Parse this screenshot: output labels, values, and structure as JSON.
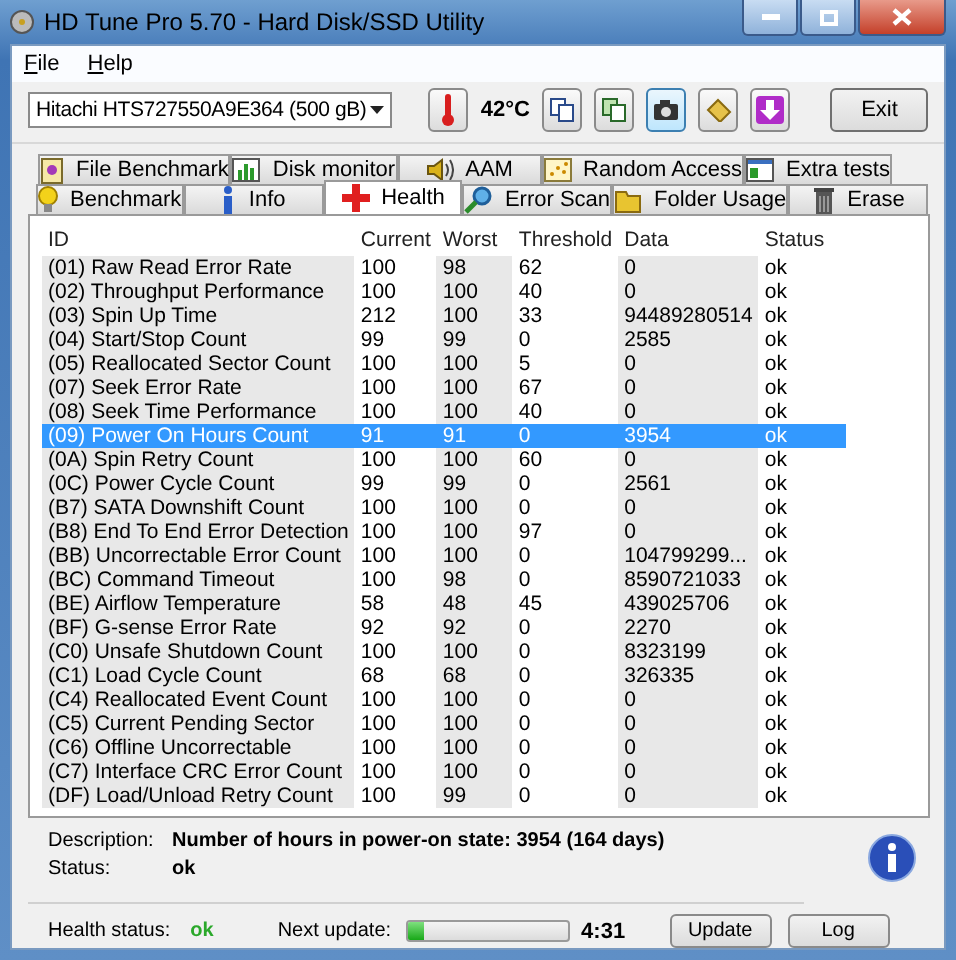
{
  "window": {
    "title": "HD Tune Pro 5.70 - Hard Disk/SSD Utility"
  },
  "menu": [
    "File",
    "Help"
  ],
  "toolbar": {
    "drive": "Hitachi HTS727550A9E364 (500 gB)",
    "temperature": "42°C",
    "exit": "Exit"
  },
  "tab_rows": [
    [
      {
        "label": "File Benchmark",
        "selected": false
      },
      {
        "label": "Disk monitor",
        "selected": false
      },
      {
        "label": "AAM",
        "selected": false
      },
      {
        "label": "Random Access",
        "selected": false
      },
      {
        "label": "Extra tests",
        "selected": false
      }
    ],
    [
      {
        "label": "Benchmark",
        "selected": false
      },
      {
        "label": "Info",
        "selected": false
      },
      {
        "label": "Health",
        "selected": true
      },
      {
        "label": "Error Scan",
        "selected": false
      },
      {
        "label": "Folder Usage",
        "selected": false
      },
      {
        "label": "Erase",
        "selected": false
      }
    ]
  ],
  "table": {
    "columns": [
      "ID",
      "Current",
      "Worst",
      "Threshold",
      "Data",
      "Status"
    ],
    "rows": [
      {
        "cells": [
          "(01) Raw Read Error Rate",
          "100",
          "98",
          "62",
          "0",
          "ok"
        ],
        "selected": false
      },
      {
        "cells": [
          "(02) Throughput Performance",
          "100",
          "100",
          "40",
          "0",
          "ok"
        ],
        "selected": false
      },
      {
        "cells": [
          "(03) Spin Up Time",
          "212",
          "100",
          "33",
          "94489280514",
          "ok"
        ],
        "selected": false
      },
      {
        "cells": [
          "(04) Start/Stop Count",
          "99",
          "99",
          "0",
          "2585",
          "ok"
        ],
        "selected": false
      },
      {
        "cells": [
          "(05) Reallocated Sector Count",
          "100",
          "100",
          "5",
          "0",
          "ok"
        ],
        "selected": false
      },
      {
        "cells": [
          "(07) Seek Error Rate",
          "100",
          "100",
          "67",
          "0",
          "ok"
        ],
        "selected": false
      },
      {
        "cells": [
          "(08) Seek Time Performance",
          "100",
          "100",
          "40",
          "0",
          "ok"
        ],
        "selected": false
      },
      {
        "cells": [
          "(09) Power On Hours Count",
          "91",
          "91",
          "0",
          "3954",
          "ok"
        ],
        "selected": true
      },
      {
        "cells": [
          "(0A) Spin Retry Count",
          "100",
          "100",
          "60",
          "0",
          "ok"
        ],
        "selected": false
      },
      {
        "cells": [
          "(0C) Power Cycle Count",
          "99",
          "99",
          "0",
          "2561",
          "ok"
        ],
        "selected": false
      },
      {
        "cells": [
          "(B7) SATA Downshift Count",
          "100",
          "100",
          "0",
          "0",
          "ok"
        ],
        "selected": false
      },
      {
        "cells": [
          "(B8) End To End Error Detection",
          "100",
          "100",
          "97",
          "0",
          "ok"
        ],
        "selected": false
      },
      {
        "cells": [
          "(BB) Uncorrectable Error Count",
          "100",
          "100",
          "0",
          "104799299...",
          "ok"
        ],
        "selected": false
      },
      {
        "cells": [
          "(BC) Command Timeout",
          "100",
          "98",
          "0",
          "8590721033",
          "ok"
        ],
        "selected": false
      },
      {
        "cells": [
          "(BE) Airflow Temperature",
          "58",
          "48",
          "45",
          "439025706",
          "ok"
        ],
        "selected": false
      },
      {
        "cells": [
          "(BF) G-sense Error Rate",
          "92",
          "92",
          "0",
          "2270",
          "ok"
        ],
        "selected": false
      },
      {
        "cells": [
          "(C0) Unsafe Shutdown Count",
          "100",
          "100",
          "0",
          "8323199",
          "ok"
        ],
        "selected": false
      },
      {
        "cells": [
          "(C1) Load Cycle Count",
          "68",
          "68",
          "0",
          "326335",
          "ok"
        ],
        "selected": false
      },
      {
        "cells": [
          "(C4) Reallocated Event Count",
          "100",
          "100",
          "0",
          "0",
          "ok"
        ],
        "selected": false
      },
      {
        "cells": [
          "(C5) Current Pending Sector",
          "100",
          "100",
          "0",
          "0",
          "ok"
        ],
        "selected": false
      },
      {
        "cells": [
          "(C6) Offline Uncorrectable",
          "100",
          "100",
          "0",
          "0",
          "ok"
        ],
        "selected": false
      },
      {
        "cells": [
          "(C7) Interface CRC Error Count",
          "100",
          "100",
          "0",
          "0",
          "ok"
        ],
        "selected": false
      },
      {
        "cells": [
          "(DF) Load/Unload Retry Count",
          "100",
          "99",
          "0",
          "0",
          "ok"
        ],
        "selected": false
      }
    ]
  },
  "details": {
    "description_label": "Description:",
    "description": "Number of hours in power-on state: 3954 (164 days)",
    "status_label": "Status:",
    "status": "ok"
  },
  "footer": {
    "health_label": "Health status:",
    "health": "ok",
    "next_update_label": "Next update:",
    "update_progress": {
      "level": 0.1
    },
    "countdown": "4:31",
    "buttons": [
      "Update",
      "Log"
    ]
  }
}
